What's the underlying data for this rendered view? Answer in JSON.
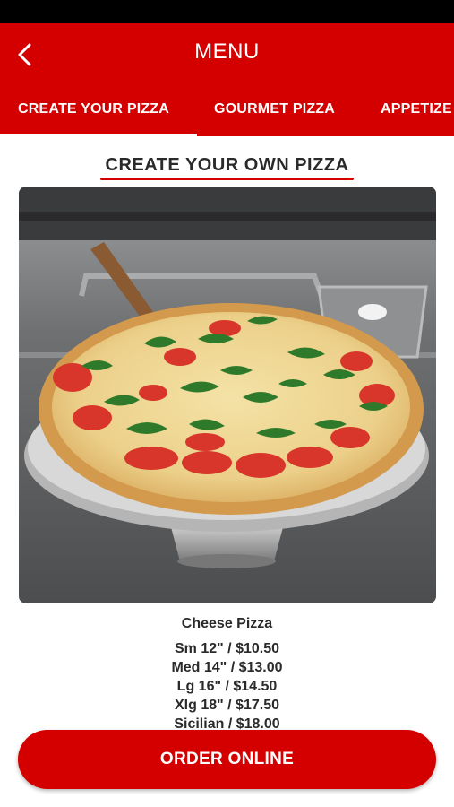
{
  "header": {
    "title": "MENU",
    "back_icon": "chevron-left-icon"
  },
  "tabs": [
    {
      "label": "CREATE YOUR PIZZA",
      "active": true
    },
    {
      "label": "GOURMET PIZZA",
      "active": false
    },
    {
      "label": "APPETIZE",
      "active": false
    }
  ],
  "section": {
    "title": "CREATE YOUR OWN PIZZA"
  },
  "product": {
    "name": "Cheese Pizza",
    "prices": [
      "Sm 12\" / $10.50",
      "Med 14\" / $13.00",
      "Lg 16\" / $14.50",
      "Xlg 18\" / $17.50",
      "Sicilian / $18.00"
    ]
  },
  "cta": {
    "label": "ORDER ONLINE"
  },
  "colors": {
    "brand_red": "#d40000",
    "text_dark": "#2a2a2a",
    "status_bar": "#000000"
  }
}
